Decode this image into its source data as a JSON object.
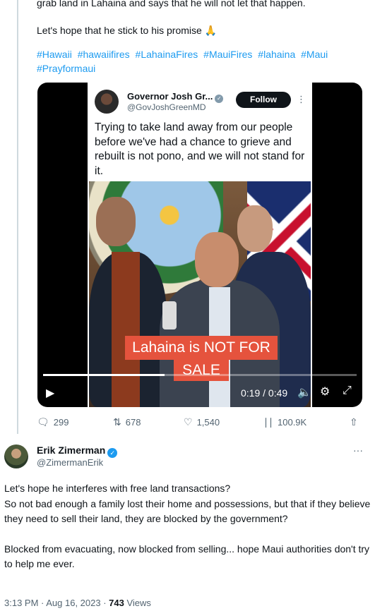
{
  "tweet1": {
    "line_top": "grab land in Lahaina and says that he will not let that happen.",
    "line_hope": "Let's hope that he stick to his promise 🙏",
    "hashtags": [
      "#Hawaii",
      "#hawaiifires",
      "#LahainaFires",
      "#MauiFires",
      "#lahaina",
      "#Maui",
      "#Prayformaui"
    ]
  },
  "embed": {
    "name": "Governor Josh Gr...",
    "handle": "@GovJoshGreenMD",
    "follow_label": "Follow",
    "more_icon": "⋮",
    "text": "Trying to take land away from our people before we've had a chance to grieve and rebuilt is not pono, and we will not stand for it."
  },
  "video": {
    "caption_line1": "Lahaina is NOT FOR",
    "caption_line2": "SALE",
    "time": "0:19 / 0:49",
    "progress": 0.388
  },
  "actions": {
    "replies": "299",
    "retweets": "678",
    "likes": "1,540",
    "views": "100.9K"
  },
  "reply": {
    "name": "Erik Zimerman",
    "handle": "@ZimermanErik",
    "more_icon": "···",
    "body": [
      "Let's hope he interferes with free land transactions?",
      "So not bad enough a family lost their home and possessions, but that if they believe they need to sell their land, they are blocked by the government?",
      "",
      "Blocked from evacuating, now blocked from selling... hope Maui authorities don't try to help me ever."
    ],
    "time": "3:13 PM · Aug 16, 2023 · ",
    "views_count": "743",
    "views_label": " Views"
  },
  "colors": {
    "accent": "#1d9bf0",
    "muted": "#536471",
    "caption_bg": "#e5533d"
  }
}
